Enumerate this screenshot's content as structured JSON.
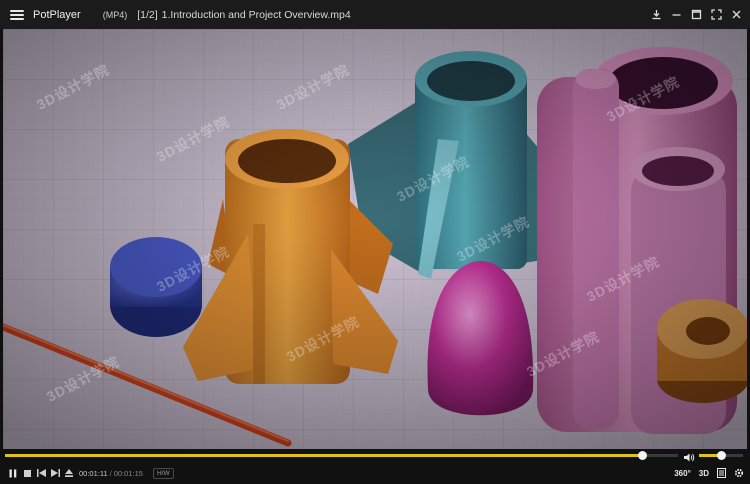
{
  "app": {
    "name": "PotPlayer",
    "format": "(MP4)",
    "playlist_position": "[1/2]",
    "file_title": "1.Introduction and Project Overview.mp4"
  },
  "playback": {
    "current_time": "00:01:11",
    "separator": "/",
    "total_time": "00:01:15",
    "progress_fraction": 0.947,
    "volume_fraction": 0.5,
    "hw_label": "H/W",
    "vr_label": "360°",
    "threed_label": "3D"
  },
  "video": {
    "watermark": "3D设计学院"
  },
  "colors": {
    "accent": "#e1c21a",
    "titlebar": "#1b1b1b",
    "controlbar": "#111111"
  },
  "icons": {
    "menu": "menu-icon",
    "download": "download-icon",
    "minimize": "minimize-icon",
    "maximize": "maximize-icon",
    "fullscreen": "fullscreen-icon",
    "close": "close-icon",
    "volume": "volume-icon",
    "pause": "pause-icon",
    "stop": "stop-icon",
    "prev": "previous-icon",
    "next": "next-icon",
    "eject": "eject-icon",
    "playlist": "playlist-icon",
    "settings": "gear-icon"
  }
}
